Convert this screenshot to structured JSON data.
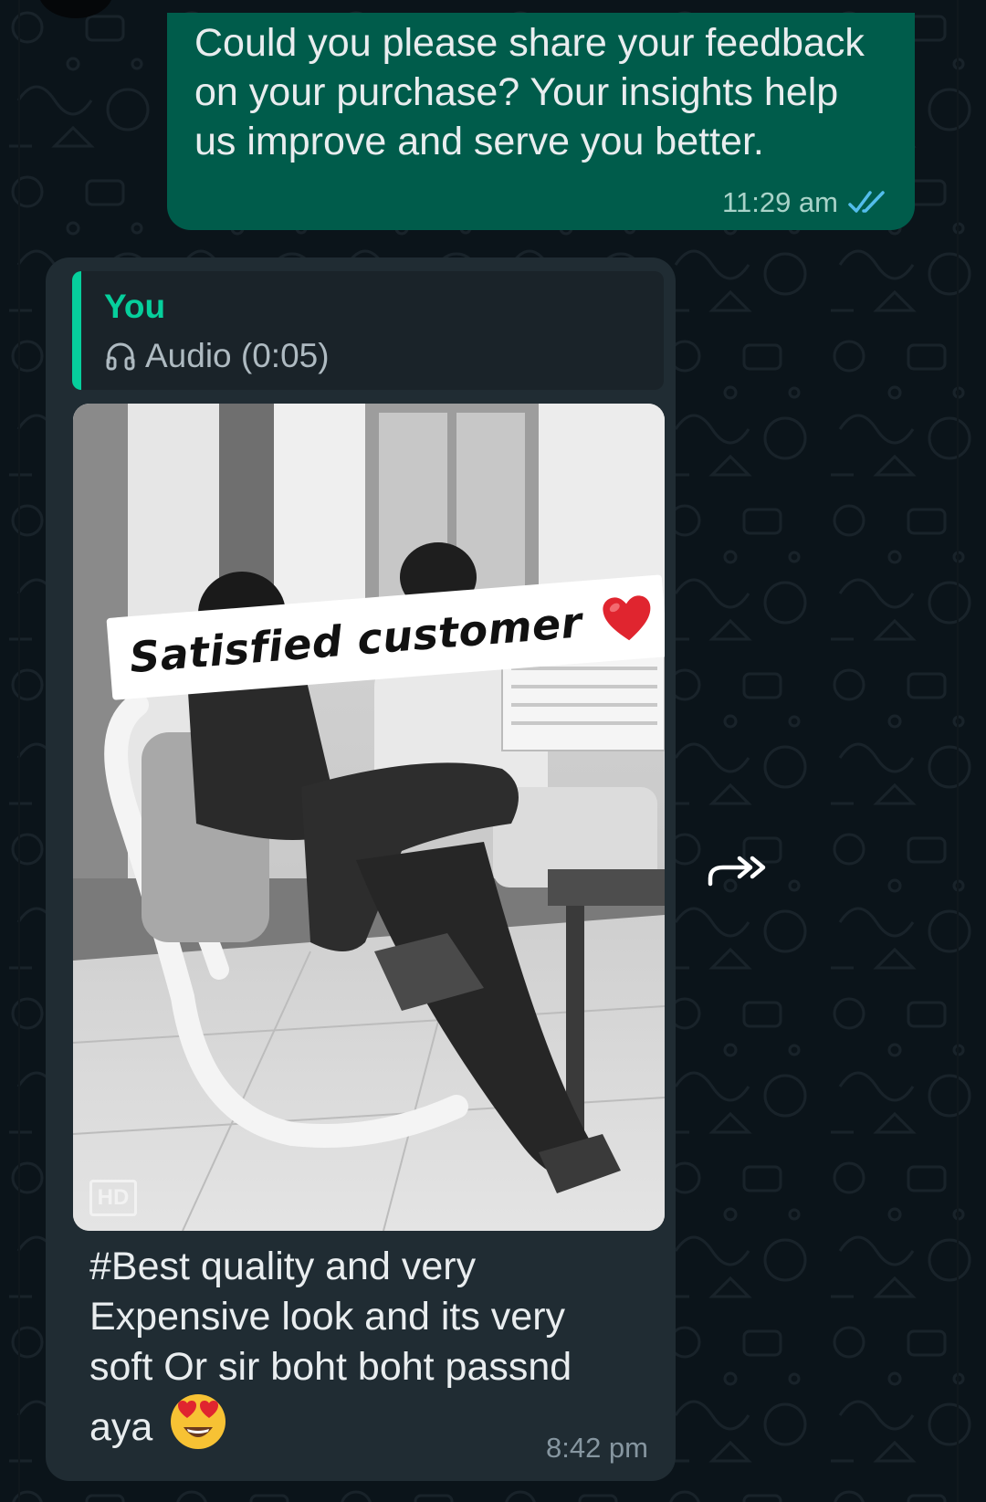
{
  "chat": {
    "outgoing_message": {
      "text": "Could you please share your feedback on your purchase? Your insights help us improve and serve you better.",
      "time": "11:29 am",
      "status_icon": "double-check-icon",
      "read_color": "#53bdeb"
    },
    "incoming_message": {
      "reply_quote": {
        "sender": "You",
        "icon": "headphones-icon",
        "body": "Audio (0:05)"
      },
      "image": {
        "overlay_text": "Satisfied customer",
        "overlay_icon": "red-heart-icon",
        "quality_badge": "HD"
      },
      "caption": "#Best quality and very Expensive look and its very soft Or sir boht boht passnd aya",
      "caption_emoji": "heart-eyes-emoji",
      "time": "8:42 pm"
    },
    "forward_icon": "forward-arrow-icon"
  },
  "colors": {
    "background": "#0b141a",
    "outgoing_bubble": "#005c4b",
    "incoming_bubble": "#202c33",
    "accent": "#06cf9c"
  }
}
